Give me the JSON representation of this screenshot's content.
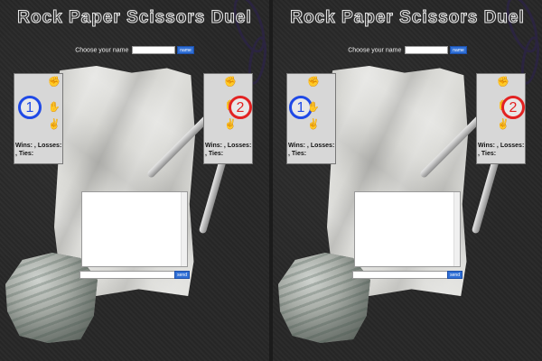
{
  "title": "Rock Paper Scissors Duel",
  "name_prompt": "Choose your name",
  "name_input_value": "",
  "name_button": "name",
  "send_button": "send",
  "chat_input_value": "",
  "players": [
    {
      "number": "1",
      "color": "#1f49e6",
      "stats": "Wins: , Losses: , Ties:"
    },
    {
      "number": "2",
      "color": "#e22222",
      "stats": "Wins: , Losses: , Ties:"
    }
  ],
  "hand_icons": [
    "rock-icon",
    "paper-icon",
    "scissors-icon"
  ],
  "hand_glyphs": [
    "✊",
    "✋",
    "✌"
  ]
}
